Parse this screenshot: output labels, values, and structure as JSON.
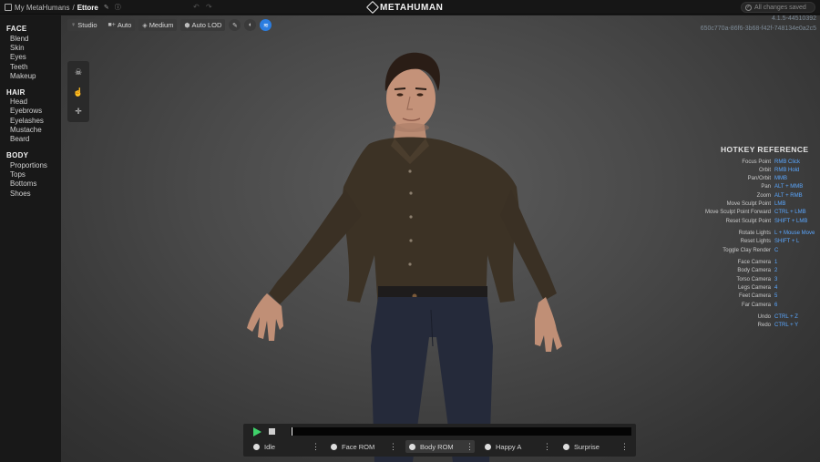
{
  "breadcrumb": {
    "parent": "My MetaHumans",
    "separator": "/",
    "current": "Ettore"
  },
  "brand": {
    "name": "METAHUMAN"
  },
  "status": {
    "saved": "All changes saved"
  },
  "version": {
    "line1": "4.1.5-44510392",
    "line2": "650c770a-86f6-3b68-f42f-748134e0a2c5"
  },
  "toolbar": {
    "studio": "Studio",
    "auto": "Auto",
    "medium": "Medium",
    "auto_lod": "Auto LOD"
  },
  "sidebar": {
    "face": {
      "title": "FACE",
      "items": [
        "Blend",
        "Skin",
        "Eyes",
        "Teeth",
        "Makeup"
      ]
    },
    "hair": {
      "title": "HAIR",
      "items": [
        "Head",
        "Eyebrows",
        "Eyelashes",
        "Mustache",
        "Beard"
      ]
    },
    "body": {
      "title": "BODY",
      "items": [
        "Proportions",
        "Tops",
        "Bottoms",
        "Shoes"
      ]
    }
  },
  "hotkeys": {
    "title": "HOTKEY REFERENCE",
    "rows": [
      {
        "label": "Focus Point",
        "key": "RMB Click"
      },
      {
        "label": "Orbit",
        "key": "RMB Hold"
      },
      {
        "label": "Pan/Orbit",
        "key": "MMB"
      },
      {
        "label": "Pan",
        "key": "ALT + MMB"
      },
      {
        "label": "Zoom",
        "key": "ALT + RMB"
      },
      {
        "label": "Move Sculpt Point",
        "key": "LMB"
      },
      {
        "label": "Move Sculpt Point Forward",
        "key": "CTRL + LMB"
      },
      {
        "label": "Reset Sculpt Point",
        "key": "SHIFT + LMB"
      },
      {
        "label": "Rotate Lights",
        "key": "L + Mouse Move"
      },
      {
        "label": "Reset Lights",
        "key": "SHIFT + L"
      },
      {
        "label": "Toggle Clay Render",
        "key": "C"
      },
      {
        "label": "Face Camera",
        "key": "1"
      },
      {
        "label": "Body Camera",
        "key": "2"
      },
      {
        "label": "Torso Camera",
        "key": "3"
      },
      {
        "label": "Legs Camera",
        "key": "4"
      },
      {
        "label": "Feet Camera",
        "key": "5"
      },
      {
        "label": "Far Camera",
        "key": "6"
      },
      {
        "label": "Undo",
        "key": "CTRL + Z"
      },
      {
        "label": "Redo",
        "key": "CTRL + Y"
      }
    ]
  },
  "animations": [
    {
      "label": "Idle"
    },
    {
      "label": "Face ROM"
    },
    {
      "label": "Body ROM"
    },
    {
      "label": "Happy A"
    },
    {
      "label": "Surprise"
    }
  ],
  "colors": {
    "accent": "#2b7de0",
    "play": "#3fd16a",
    "hotkey": "#5aa7ff"
  }
}
